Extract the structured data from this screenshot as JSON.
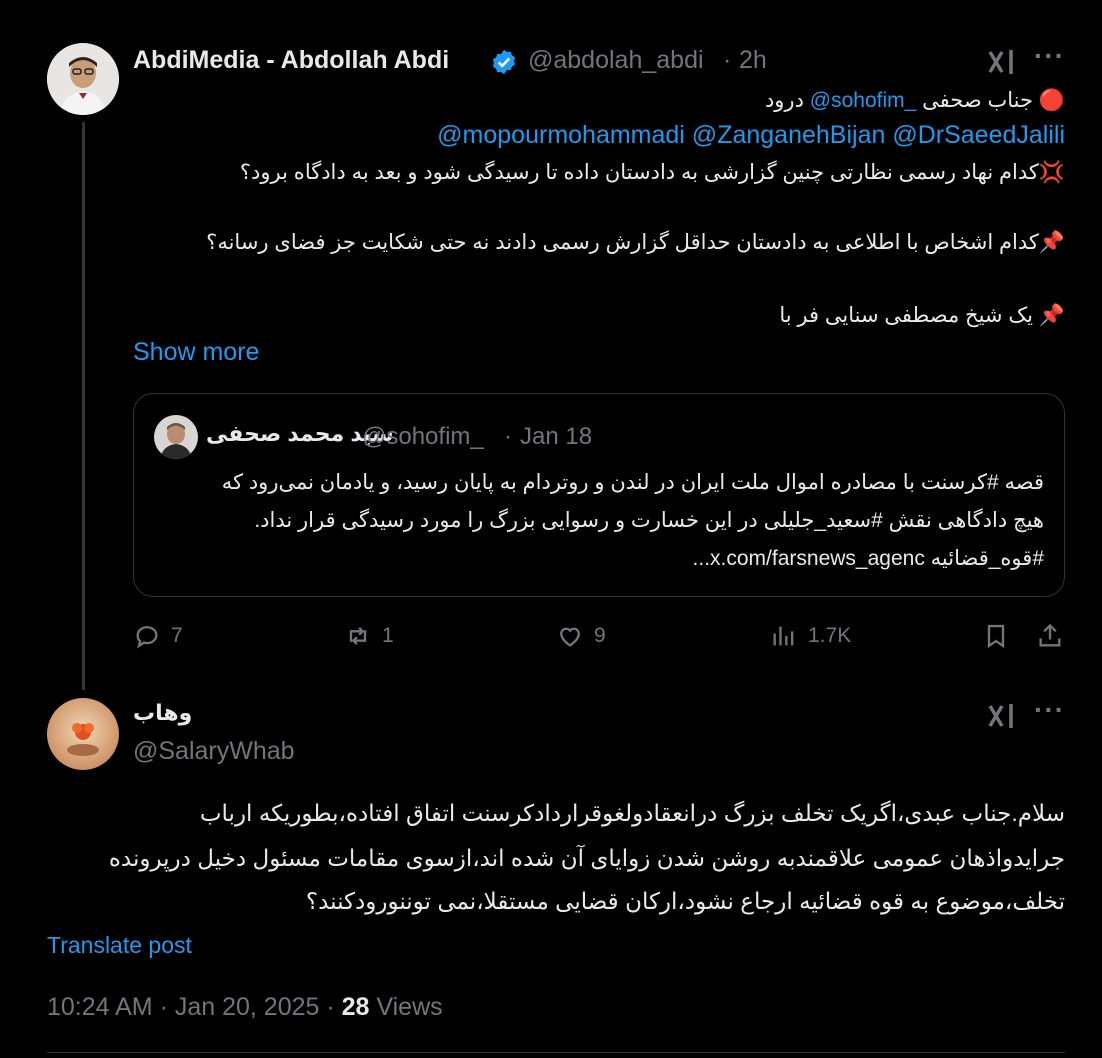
{
  "main_post": {
    "author_name": "AbdiMedia - Abdollah Abdi",
    "author_handle": "@abdolah_abdi",
    "time_sep": "·",
    "time": "2h",
    "line1_prefix_emoji": "🔴",
    "line1_text": "جناب صحفی",
    "line1_mention": "@sohofim_",
    "line1_suffix": "درود",
    "line2_mentions": "@mopourmohammadi @ZanganehBijan @DrSaeedJalili",
    "para1": "💢کدام نهاد رسمی نظارتی چنین گزارشی به دادستان داده تا رسیدگی شود و بعد به دادگاه برود؟",
    "para2": "📌کدام اشخاص با اطلاعی به دادستان حداقل گزارش رسمی دادند نه حتی شکایت جز فضای رسانه؟",
    "para3": "📌 یک شیخ مصطفی سنایی فر با",
    "show_more": "Show more"
  },
  "quoted_post": {
    "author_name": "سید محمد صحفی",
    "author_handle": "@sohofim_",
    "time_sep": "·",
    "date": "Jan 18",
    "line1": "قصه #کرسنت با مصادره اموال ملت ایران در لندن و روتردام به پایان رسید، و یادمان نمی‌رود که",
    "line2": "هیچ دادگاهی نقش #سعید_جلیلی در این خسارت و رسوایی بزرگ را مورد رسیدگی قرار نداد.",
    "line3": "#قوه_قضائیه x.com/farsnews_agenc..."
  },
  "actions": {
    "replies": "7",
    "reposts": "1",
    "likes": "9",
    "views": "1.7K"
  },
  "reply_post": {
    "author_name": "وهاب",
    "author_handle": "@SalaryWhab",
    "line1": "سلام.جناب عبدی،اگریک تخلف بزرگ درانعقادولغوقراردادکرسنت اتفاق افتاده،بطوریکه ارباب",
    "line2": "جرایدواذهان عمومی علاقمندبه روشن شدن زوایای آن شده اند،ازسوی مقامات مسئول دخیل درپرونده",
    "line3": "تخلف،موضوع به قوه قضائیه ارجاع نشود،ارکان قضایی مستقلا،نمی توننورودکنند؟",
    "translate": "Translate post",
    "timestamp": "10:24 AM · Jan 20, 2025 ·",
    "views_count": "28",
    "views_label": "Views"
  },
  "colors": {
    "background": "#000000",
    "text": "#e7e9ea",
    "muted": "#71767b",
    "link": "#1d9bf0",
    "border": "#2f3336",
    "verified": "#1d9bf0"
  },
  "icons": [
    "grok-icon",
    "more-icon",
    "verified-badge-icon",
    "reply-icon",
    "repost-icon",
    "like-icon",
    "views-icon",
    "bookmark-icon",
    "share-icon"
  ]
}
